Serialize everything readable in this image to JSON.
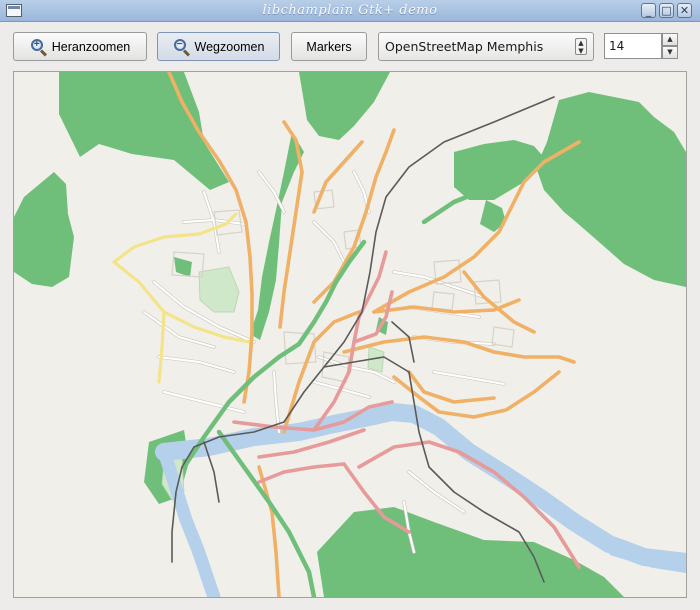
{
  "window": {
    "title": "libchamplain Gtk+ demo",
    "controls": {
      "minimize": "_",
      "maximize": "□",
      "close": "✕"
    }
  },
  "toolbar": {
    "zoom_in_label": "Heranzoomen",
    "zoom_out_label": "Wegzoomen",
    "markers_label": "Markers",
    "zoom_in_icon": "zoom-in-icon",
    "zoom_out_icon": "zoom-out-icon",
    "map_source": {
      "selected": "OpenStreetMap Memphis"
    },
    "zoom_level": "14"
  },
  "colors": {
    "forest": "#6fbf7a",
    "major_road": "#f0b066",
    "primary_road": "#e79a9a",
    "secondary_road": "#f3e48a",
    "river": "#b5d0ea",
    "map_background": "#f1efea",
    "railway": "#5a5a5a"
  }
}
